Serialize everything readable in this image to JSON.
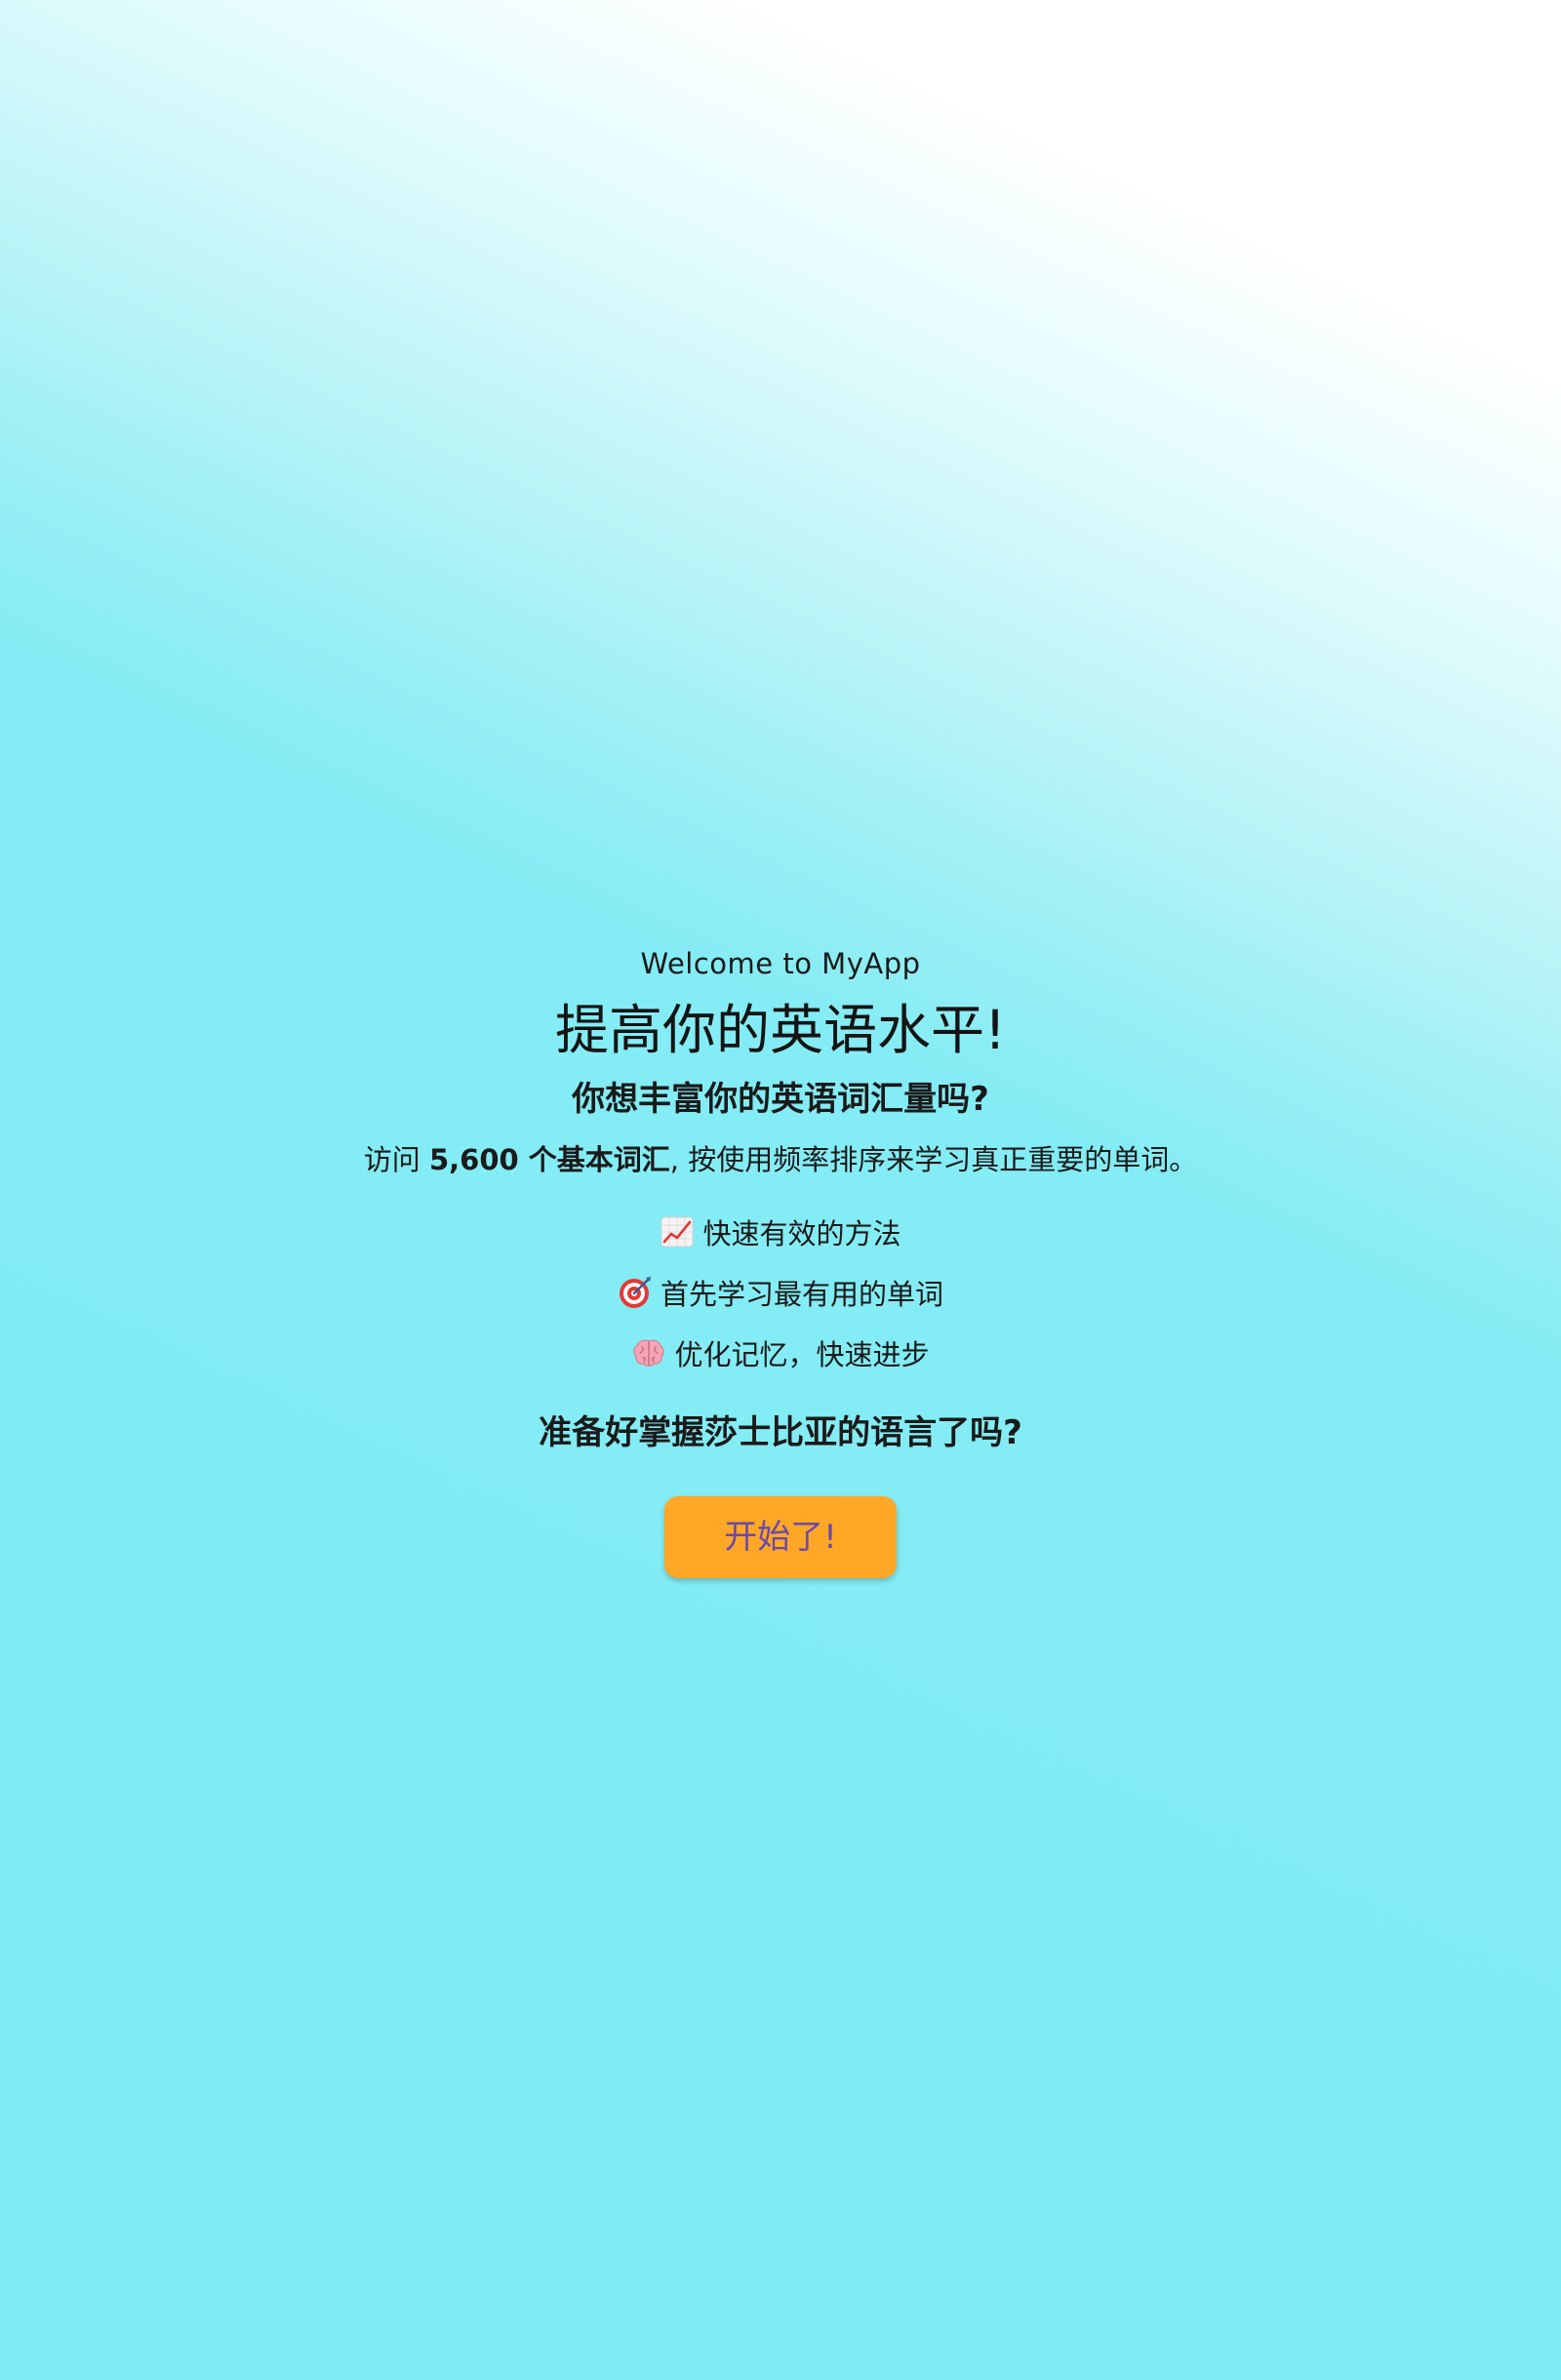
{
  "welcome": {
    "subtitle": "Welcome to MyApp",
    "headline": "提高你的英语水平!",
    "question": "你想丰富你的英语词汇量吗?",
    "intro": {
      "prefix": "访问 ",
      "highlight": "5,600 个基本词汇",
      "suffix": ", 按使用频率排序来学习真正重要的单词。"
    },
    "features": [
      {
        "icon": "chart-increasing-icon",
        "label": "快速有效的方法"
      },
      {
        "icon": "target-icon",
        "label": "首先学习最有用的单词"
      },
      {
        "icon": "brain-icon",
        "label": "优化记忆，快速进步"
      }
    ],
    "cta_question": "准备好掌握莎士比亚的语言了吗?",
    "start_button": "开始了!"
  },
  "colors": {
    "background_top": "#ffffff",
    "background_main": "#80ecf4",
    "button": "#ffa726",
    "button_text": "#6a4aa8"
  }
}
